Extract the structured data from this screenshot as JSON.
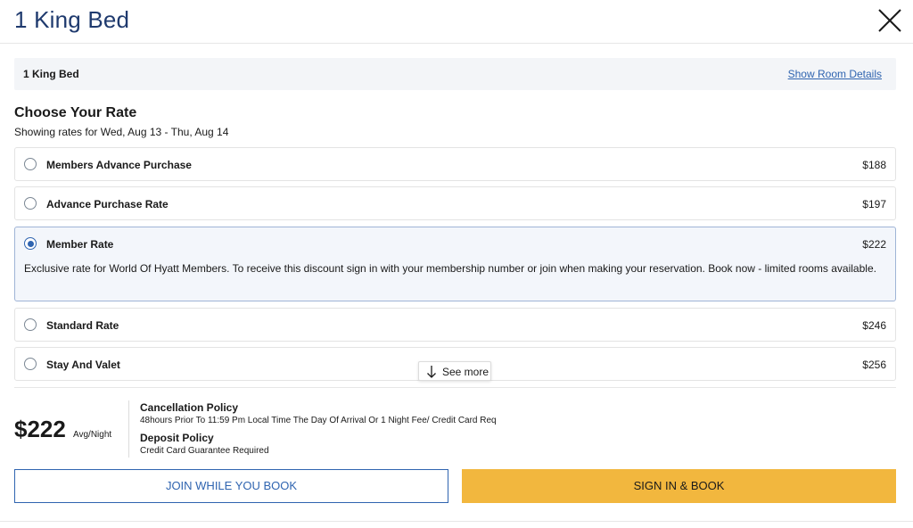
{
  "header": {
    "title": "1 King Bed"
  },
  "room_bar": {
    "label": "1 King Bed",
    "details_link": "Show Room Details"
  },
  "rates_section": {
    "title": "Choose Your Rate",
    "subtitle": "Showing rates for Wed, Aug 13 - Thu, Aug 14"
  },
  "rates": [
    {
      "name": "Members Advance Purchase",
      "price": "$188",
      "selected": false
    },
    {
      "name": "Advance Purchase Rate",
      "price": "$197",
      "selected": false
    },
    {
      "name": "Member Rate",
      "price": "$222",
      "selected": true,
      "description": "Exclusive rate for World Of Hyatt Members. To receive this discount sign in with your membership number or join when making your reservation. Book now - limited rooms available."
    },
    {
      "name": "Standard Rate",
      "price": "$246",
      "selected": false
    },
    {
      "name": "Stay And Valet",
      "price": "$256",
      "selected": false
    }
  ],
  "see_more": {
    "label": "See more"
  },
  "summary": {
    "price": "$222",
    "unit": "Avg/Night",
    "cancellation_title": "Cancellation Policy",
    "cancellation_text": "48hours Prior To 11:59 Pm Local Time The Day Of Arrival Or 1 Night Fee/ Credit Card Req",
    "deposit_title": "Deposit Policy",
    "deposit_text": "Credit Card Guarantee Required"
  },
  "actions": {
    "join_label": "JOIN WHILE YOU BOOK",
    "book_label": "SIGN IN & BOOK"
  },
  "colors": {
    "accent": "#2f64b0",
    "title": "#1f3a6e",
    "book_button": "#f2b73e",
    "selected_bg": "#f3f6fb"
  }
}
